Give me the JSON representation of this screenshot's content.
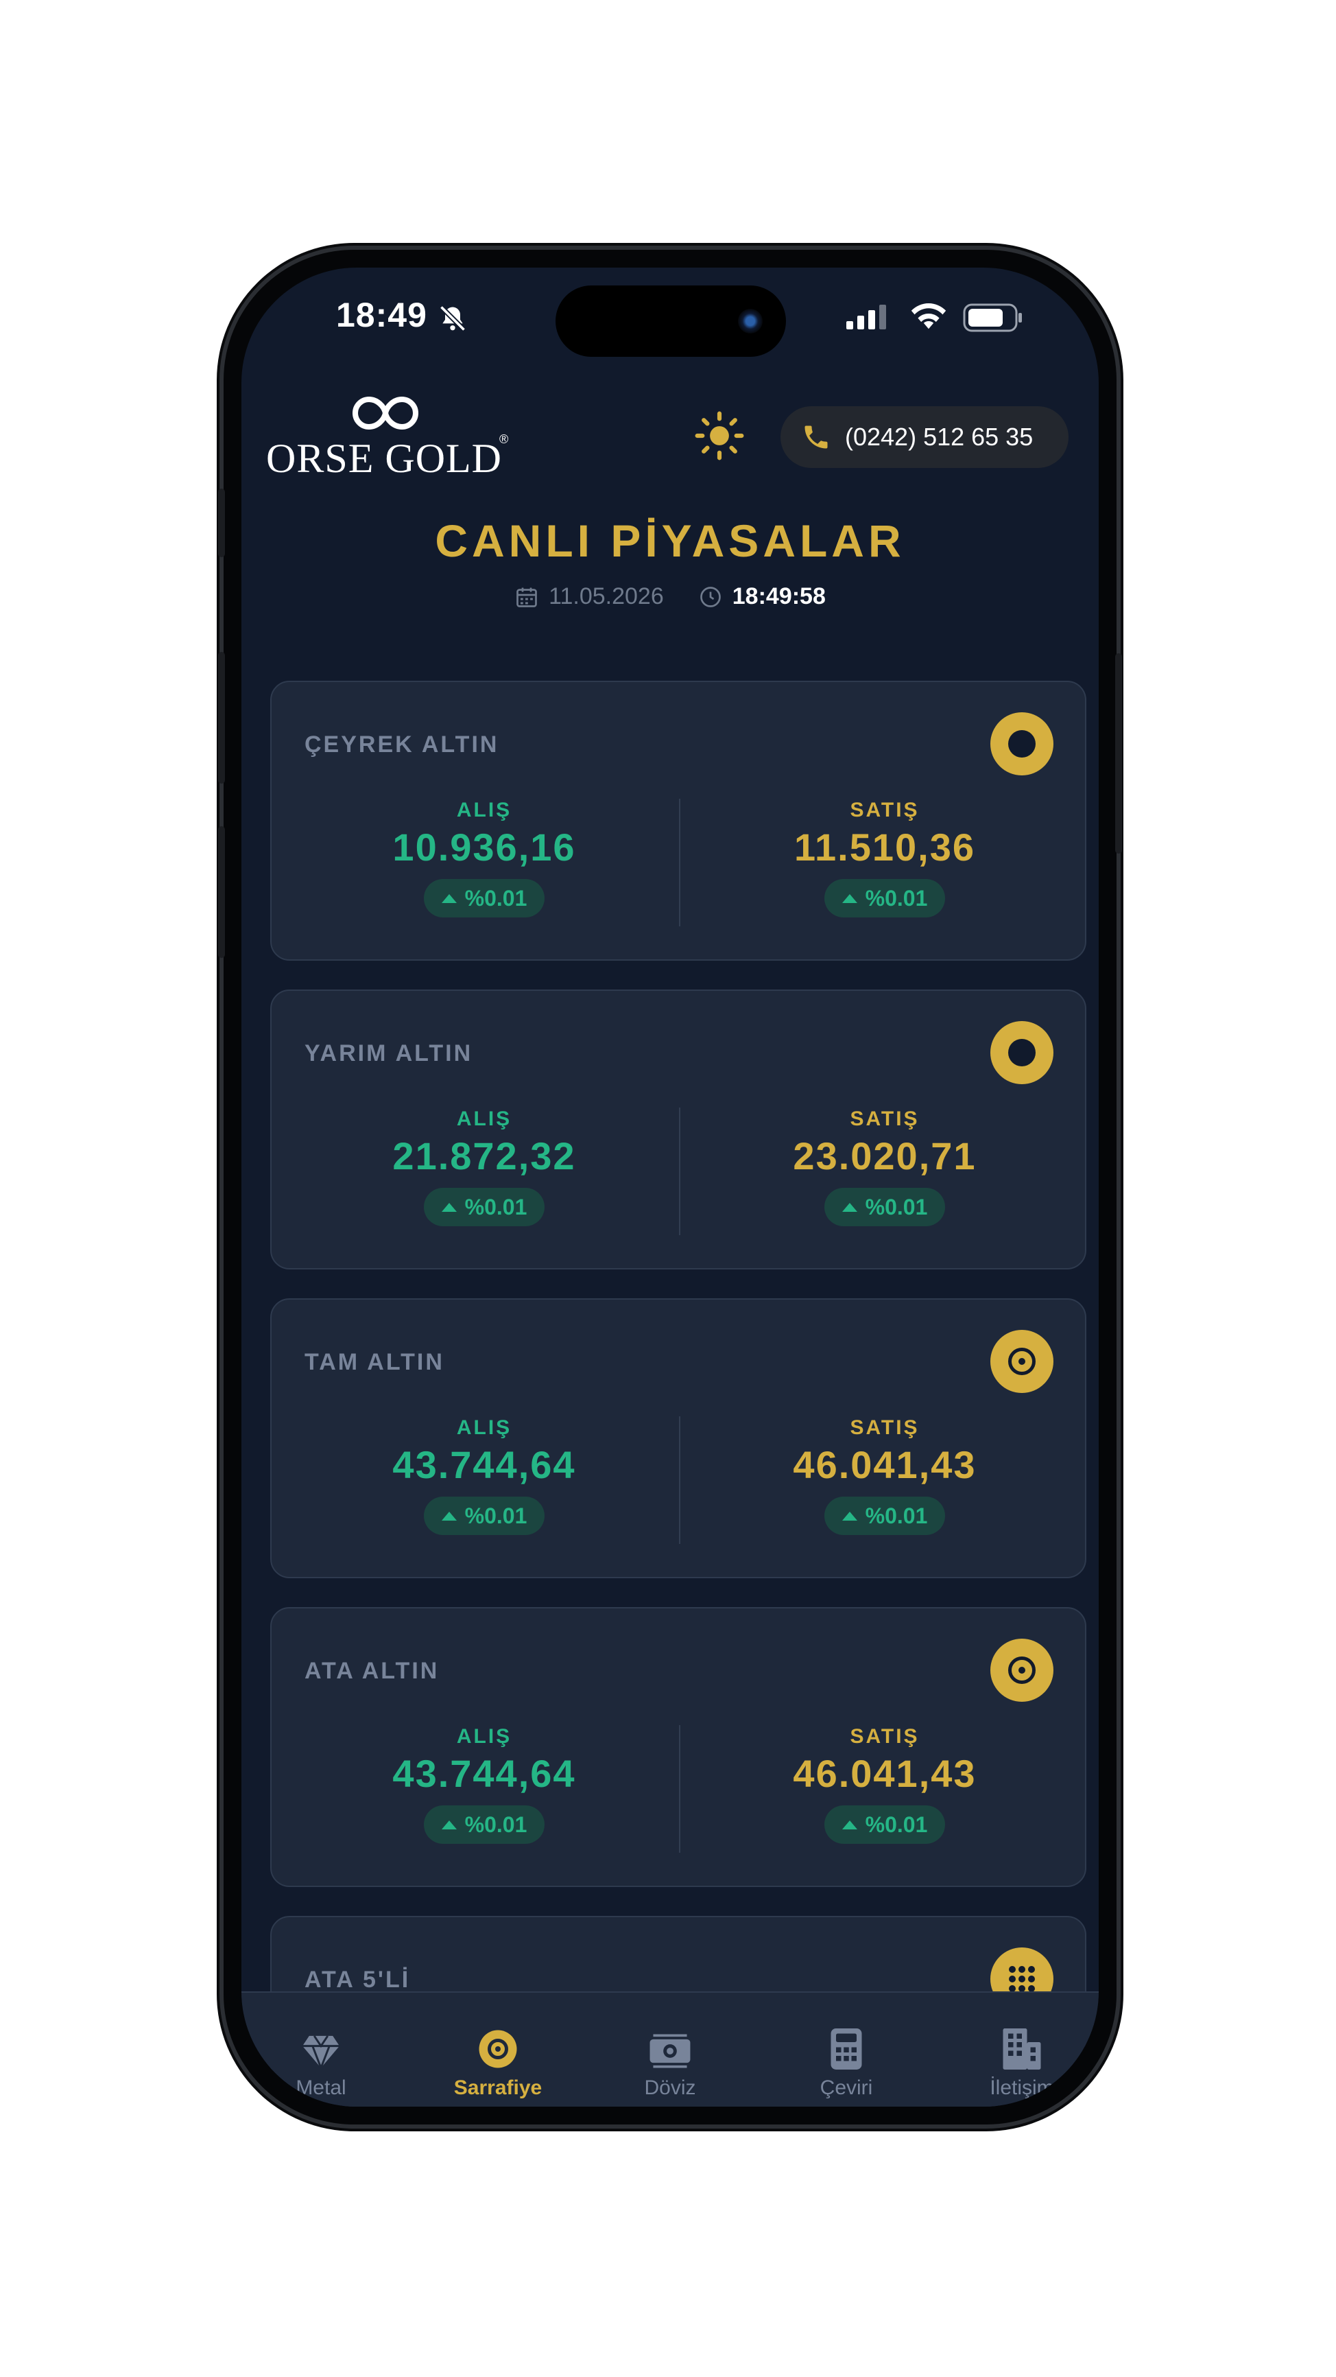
{
  "status_bar": {
    "time": "18:49"
  },
  "header": {
    "logo_text": "ORSE GOLD",
    "logo_reg": "®",
    "phone": "(0242) 512 65 35"
  },
  "page": {
    "title": "CANLI PİYASALAR",
    "date": "11.05.2026",
    "time": "18:49:58"
  },
  "labels": {
    "buy": "ALIŞ",
    "sell": "SATIŞ"
  },
  "cards": [
    {
      "name": "ÇEYREK ALTIN",
      "icon": "coin-ring-icon",
      "buy": "10.936,16",
      "buy_change": "%0.01",
      "sell": "11.510,36",
      "sell_change": "%0.01"
    },
    {
      "name": "YARIM ALTIN",
      "icon": "coin-ring-icon",
      "buy": "21.872,32",
      "buy_change": "%0.01",
      "sell": "23.020,71",
      "sell_change": "%0.01"
    },
    {
      "name": "TAM ALTIN",
      "icon": "coin-target-icon",
      "buy": "43.744,64",
      "buy_change": "%0.01",
      "sell": "46.041,43",
      "sell_change": "%0.01"
    },
    {
      "name": "ATA ALTIN",
      "icon": "coin-target-icon",
      "buy": "43.744,64",
      "buy_change": "%0.01",
      "sell": "46.041,43",
      "sell_change": "%0.01"
    },
    {
      "name": "ATA 5'Lİ",
      "icon": "dots-grid-icon"
    }
  ],
  "tabs": [
    {
      "label": "Metal",
      "icon": "diamond-icon",
      "active": false
    },
    {
      "label": "Sarrafiye",
      "icon": "coin-icon",
      "active": true
    },
    {
      "label": "Döviz",
      "icon": "banknote-icon",
      "active": false
    },
    {
      "label": "Çeviri",
      "icon": "calculator-icon",
      "active": false
    },
    {
      "label": "İletişim",
      "icon": "building-icon",
      "active": false
    }
  ],
  "colors": {
    "background": "#111a2c",
    "card": "#1e283a",
    "gold": "#d6b040",
    "green": "#25b686"
  }
}
